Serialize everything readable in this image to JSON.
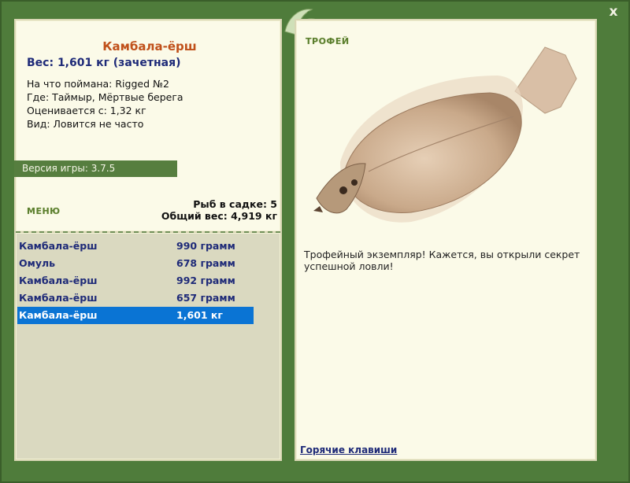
{
  "close_label": "x",
  "fish": {
    "title": "Камбала-ёрш",
    "weight_line": "Вес: 1,601 кг (зачетная)",
    "details": [
      "На что поймана: Rigged №2",
      "Где: Таймыр, Мёртвые берега",
      "Оценивается с: 1,32 кг",
      "Вид: Ловится не часто"
    ]
  },
  "version": "Версия игры: 3.7.5",
  "menu_label": "МЕНЮ",
  "keep": {
    "count_line": "Рыб в садке: 5",
    "total_line": "Общий вес: 4,919 кг"
  },
  "catches": [
    {
      "name": "Камбала-ёрш",
      "weight": "990 грамм"
    },
    {
      "name": "Омуль",
      "weight": "678 грамм"
    },
    {
      "name": "Камбала-ёрш",
      "weight": "992 грамм"
    },
    {
      "name": "Камбала-ёрш",
      "weight": "657 грамм"
    },
    {
      "name": "Камбала-ёрш",
      "weight": "1,601 кг"
    }
  ],
  "selected_index": 4,
  "trophy_label": "ТРОФЕЙ",
  "trophy_text": "Трофейный экземпляр! Кажется, вы открыли секрет успешной ловли!",
  "hotkeys": "Горячие клавиши",
  "colors": {
    "frame": "#4f7c3b",
    "panel": "#fbfae8",
    "selected": "#0a74d4",
    "title": "#c0501a",
    "accent_text": "#1e2a78"
  },
  "icons": {
    "close": "close-icon",
    "logo": "fish-logo-icon"
  }
}
